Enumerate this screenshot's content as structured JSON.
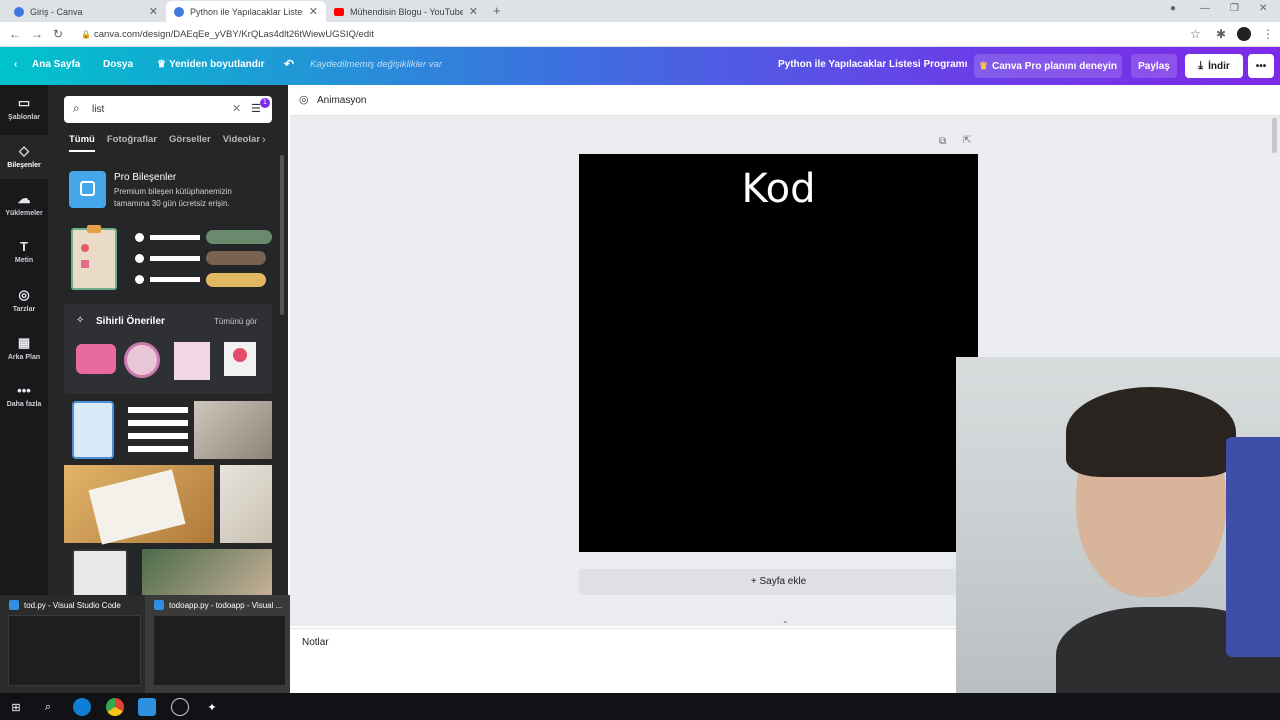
{
  "browser": {
    "tabs": [
      {
        "label": "Giriş - Canva",
        "active": false
      },
      {
        "label": "Python ile Yapılacaklar Listesi Pro",
        "active": true
      },
      {
        "label": "Mühendisin Blogu - YouTube",
        "active": false
      }
    ],
    "url": "canva.com/design/DAEqEe_yVBY/KrQLas4dlt26tWiewUGSIQ/edit"
  },
  "header": {
    "home": "Ana Sayfa",
    "file": "Dosya",
    "resize": "Yeniden boyutlandır",
    "unsaved": "Kaydedilmemiş değişiklikler var",
    "design_title": "Python ile Yapılacaklar Listesi Programı",
    "pro_cta": "Canva Pro planını deneyin",
    "share": "Paylaş",
    "download": "İndir"
  },
  "rail": {
    "items": [
      {
        "label": "Şablonlar",
        "icon": "layout-icon"
      },
      {
        "label": "Bileşenler",
        "icon": "shapes-icon"
      },
      {
        "label": "Yüklemeler",
        "icon": "cloud-upload-icon"
      },
      {
        "label": "Metin",
        "icon": "text-icon"
      },
      {
        "label": "Tarzlar",
        "icon": "palette-icon"
      },
      {
        "label": "Arka Plan",
        "icon": "background-icon"
      },
      {
        "label": "Daha fazla",
        "icon": "more-icon"
      }
    ]
  },
  "panel": {
    "search_value": "list",
    "filter_badge": "1",
    "tabs": [
      "Tümü",
      "Fotoğraflar",
      "Görseller",
      "Videolar"
    ],
    "pro": {
      "title": "Pro Bileşenler",
      "desc_line1": "Premium bileşen kütüphanemizin",
      "desc_line2": "tamamına 30 gün ücretsiz erişin."
    },
    "magic": {
      "title": "Sihirli Öneriler",
      "see_all": "Tümünü gör"
    }
  },
  "toolbar": {
    "animation": "Animasyon"
  },
  "canvas": {
    "page_title": "Kod",
    "add_page": "+ Sayfa ekle",
    "notes": "Notlar"
  },
  "taskbar_preview": [
    {
      "title": "tod.py - Visual Studio Code"
    },
    {
      "title": "todoapp.py - todoapp - Visual ..."
    }
  ]
}
